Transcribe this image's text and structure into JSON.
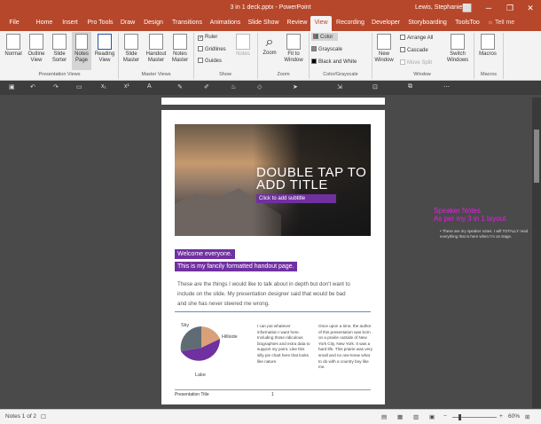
{
  "window": {
    "title": "3 in 1 deck.pptx  -  PowerPoint",
    "user": "Lewis, Stephanie",
    "controls": [
      "⬜",
      "─",
      "❐",
      "✕"
    ]
  },
  "tabs": [
    "File",
    "Home",
    "Insert",
    "Pro Tools",
    "Draw",
    "Design",
    "Transitions",
    "Animations",
    "Slide Show",
    "Review",
    "View",
    "Recording",
    "Developer",
    "Storyboarding",
    "ToolsToo",
    "Tell me"
  ],
  "ribbon": {
    "presentation_views": {
      "label": "Presentation Views",
      "buttons": [
        "Normal",
        "Outline View",
        "Slide Sorter",
        "Notes Page",
        "Reading View"
      ]
    },
    "master_views": {
      "label": "Master Views",
      "buttons": [
        "Slide Master",
        "Handout Master",
        "Notes Master"
      ]
    },
    "show": {
      "label": "Show",
      "checks": [
        {
          "label": "Ruler",
          "checked": true
        },
        {
          "label": "Gridlines",
          "checked": false
        },
        {
          "label": "Guides",
          "checked": false
        }
      ],
      "notes": "Notes"
    },
    "zoom": {
      "label": "Zoom",
      "buttons": [
        "Zoom",
        "Fit to Window"
      ]
    },
    "color": {
      "label": "Color/Grayscale",
      "options": [
        "Color",
        "Grayscale",
        "Black and White"
      ]
    },
    "window": {
      "label": "Window",
      "buttons": [
        "New Window",
        "Arrange All",
        "Cascade",
        "Move Split",
        "Switch Windows"
      ]
    },
    "macros": {
      "label": "Macros",
      "buttons": [
        "Macros"
      ]
    }
  },
  "page": {
    "slide_title": "DOUBLE TAP TO ADD TITLE",
    "slide_subtitle": "Click to add subtitle",
    "highlight1": "Welcome everyone.",
    "highlight2": "This is my fancily formatted handout page.",
    "body": "These are the things I would like to talk about in depth but don't want to include on the slide. My presentation designer said that would be bad and she has never steered me wrong.",
    "pie": {
      "labels": [
        "Sky",
        "Hillside",
        "Lake"
      ]
    },
    "col1": "I can put whatever information I want here. Including those ridiculous biographies and extra data to support my point. Like this silly pie chart here that looks like nature.",
    "col2": "Once upon a time, the author of this presentation was born on a prairie outside of New York City, New York. It was a hard life. This prairie was very small and no one knew what to do with a country boy like me.",
    "footer": "Presentation Title",
    "page_num": "1"
  },
  "speaker": {
    "heading": "Speaker Notes\nAs per my 3 in 1 layout",
    "note": "These are my speaker notes. I will TOTALLY read everything that is here when I'm on stage."
  },
  "colors": {
    "accent": "#b7472a",
    "purple": "#7030a0",
    "magenta": "#e020e0"
  },
  "status": {
    "notes": "Notes 1 of 2",
    "zoom": "60%"
  }
}
